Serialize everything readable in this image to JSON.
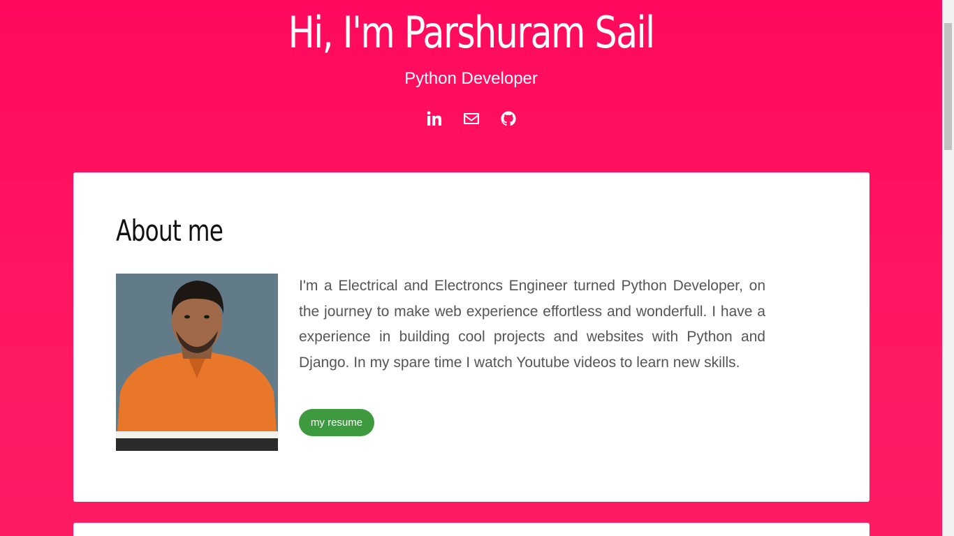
{
  "hero": {
    "title": "Hi, I'm Parshuram Sail",
    "subtitle": "Python Developer",
    "socials": [
      {
        "icon": "linkedin-icon"
      },
      {
        "icon": "mail-icon"
      },
      {
        "icon": "github-icon"
      }
    ]
  },
  "about": {
    "heading": "About me",
    "bio": "I'm a Electrical and Electroncs Engineer turned Python Developer, on the journey to make web experience effortless and wonderfull. I have a experience in building cool projects and websites with Python and Django. In my spare time I watch Youtube videos to learn new skills.",
    "resume_label": "my resume"
  },
  "colors": {
    "background": "#ff0a5e",
    "card": "#ffffff",
    "button": "#3e9a3e"
  }
}
